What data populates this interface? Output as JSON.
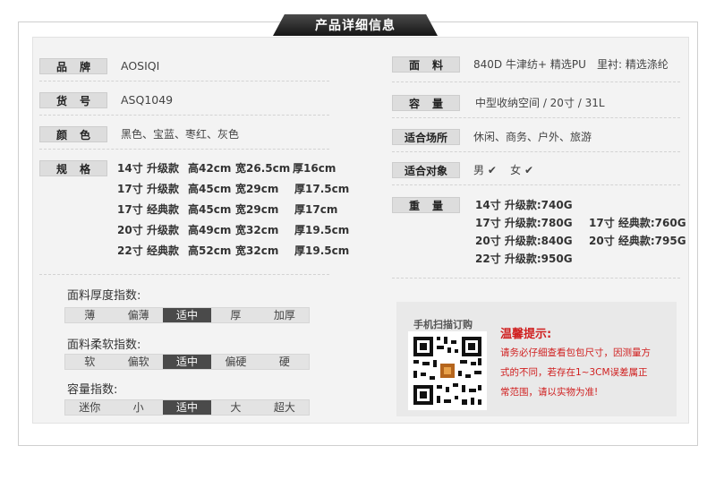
{
  "header": {
    "title": "产品详细信息"
  },
  "left": {
    "brand": {
      "label": [
        "品",
        "牌"
      ],
      "value": "AOSIQI"
    },
    "model": {
      "label": [
        "货",
        "号"
      ],
      "value": "ASQ1049"
    },
    "color": {
      "label": [
        "颜",
        "色"
      ],
      "value": "黑色、宝蓝、枣红、灰色"
    },
    "spec": {
      "label": [
        "规",
        "格"
      ],
      "rows": [
        {
          "size": "14寸",
          "type": "升级款",
          "h": "高42cm",
          "w": "宽26.5cm",
          "d": "厚16cm"
        },
        {
          "size": "17寸",
          "type": "升级款",
          "h": "高45cm",
          "w": "宽29cm",
          "d": "厚17.5cm"
        },
        {
          "size": "17寸",
          "type": "经典款",
          "h": "高45cm",
          "w": "宽29cm",
          "d": "厚17cm"
        },
        {
          "size": "20寸",
          "type": "升级款",
          "h": "高49cm",
          "w": "宽32cm",
          "d": "厚19.5cm"
        },
        {
          "size": "22寸",
          "type": "经典款",
          "h": "高52cm",
          "w": "宽32cm",
          "d": "厚19.5cm"
        }
      ]
    }
  },
  "right": {
    "fabric": {
      "label": [
        "面",
        "料"
      ],
      "value": "840D 牛津纺+ 精选PU",
      "lining": "里衬: 精选涤纶"
    },
    "capacity": {
      "label": [
        "容",
        "量"
      ],
      "value": "中型收纳空间 / 20寸 / 31L"
    },
    "occasion": {
      "label": "适合场所",
      "value": "休闲、商务、户外、旅游"
    },
    "target": {
      "label": "适合对象",
      "male": "男",
      "female": "女",
      "check": "✔"
    },
    "weight": {
      "label": [
        "重",
        "量"
      ],
      "col1": [
        "14寸 升级款:740G",
        "17寸 升级款:780G",
        "20寸 升级款:840G",
        "22寸 升级款:950G"
      ],
      "col2": [
        "17寸 经典款:760G",
        "20寸 经典款:795G"
      ]
    }
  },
  "indices": [
    {
      "title": "面料厚度指数:",
      "options": [
        "薄",
        "偏薄",
        "适中",
        "厚",
        "加厚"
      ],
      "selected": 2
    },
    {
      "title": "面料柔软指数:",
      "options": [
        "软",
        "偏软",
        "适中",
        "偏硬",
        "硬"
      ],
      "selected": 2
    },
    {
      "title": "容量指数:",
      "options": [
        "迷你",
        "小",
        "适中",
        "大",
        "超大"
      ],
      "selected": 2
    }
  ],
  "qr": {
    "caption": "手机扫描订购"
  },
  "tips": {
    "title": "温馨提示:",
    "lines": [
      "请务必仔细查看包包尺寸，因测量方",
      "式的不同，若存在1~3CM误差属正",
      "常范围，请以实物为准!"
    ]
  },
  "colors": {
    "selected_segment": "#4a4a4a",
    "tip_red": "#d02020"
  }
}
